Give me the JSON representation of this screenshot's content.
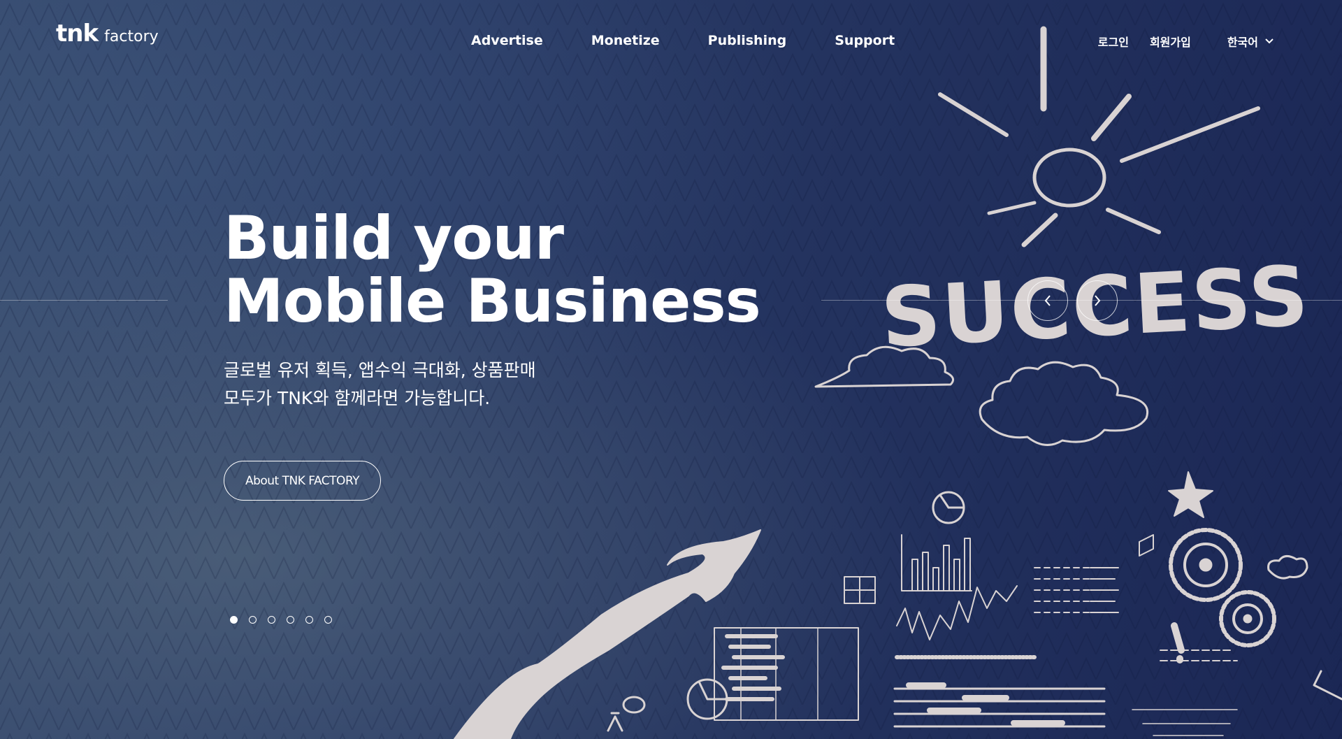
{
  "header": {
    "logo_main": "tnk",
    "logo_sub": "factory",
    "nav": [
      "Advertise",
      "Monetize",
      "Publishing",
      "Support"
    ],
    "login": "로그인",
    "signup": "회원가입",
    "language": "한국어"
  },
  "hero": {
    "headline_line1": "Build your",
    "headline_line2": "Mobile Business",
    "sub_line1": "글로벌 유저 획득, 앱수익 극대화, 상품판매",
    "sub_line2": "모두가 TNK와 함께라면 가능합니다.",
    "cta_label": "About TNK FACTORY",
    "art_word": "SUCCESS"
  },
  "slider": {
    "slide_count": 6,
    "active_index": 0
  },
  "colors": {
    "background": "#24345f",
    "text": "#ffffff",
    "sketch": "#d9d3d3"
  }
}
